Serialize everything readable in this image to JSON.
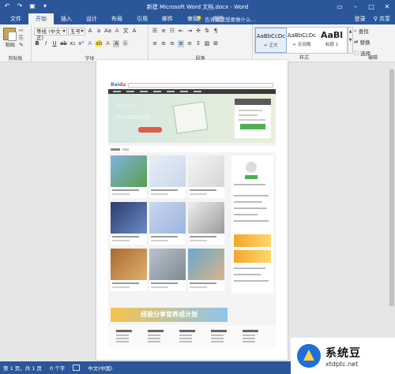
{
  "window": {
    "title": "新建 Microsoft Word 文档.docx - Word"
  },
  "qat": [
    "undo-icon",
    "redo-icon",
    "save-icon",
    "customize-icon"
  ],
  "menu": {
    "tabs": [
      "文件",
      "开始",
      "插入",
      "设计",
      "布局",
      "引用",
      "邮件",
      "审阅",
      "视图"
    ],
    "active": "开始",
    "tell_me": "告诉我您想要做什么...",
    "signin": "登录",
    "share": "共享"
  },
  "ribbon": {
    "clipboard": {
      "paste": "粘贴",
      "label": "剪贴板"
    },
    "font": {
      "family": "等线 (中文正)",
      "size": "五号",
      "label": "字体"
    },
    "paragraph": {
      "label": "段落"
    },
    "styles": {
      "items": [
        {
          "preview": "AaBbCcDc",
          "name": "↵ 正文"
        },
        {
          "preview": "AaBbCcDc",
          "name": "↵ 无间隔"
        },
        {
          "preview": "AaBl",
          "name": "标题 1"
        }
      ],
      "label": "样式"
    },
    "editing": {
      "find": "查找",
      "replace": "替换",
      "select": "选择",
      "label": "编辑"
    }
  },
  "document": {
    "screenshot_banner_text": "经验分享官养成计划"
  },
  "statusbar": {
    "page": "第 1 页，共 1 页",
    "words": "0 个字",
    "language": "中文(中国)"
  },
  "watermark": {
    "cn": "系统豆",
    "en": "xtdptc.net"
  },
  "colors": {
    "titlebar": "#2b579a",
    "ribbon": "#f3f3f3",
    "canvas": "#e6e6e6"
  }
}
